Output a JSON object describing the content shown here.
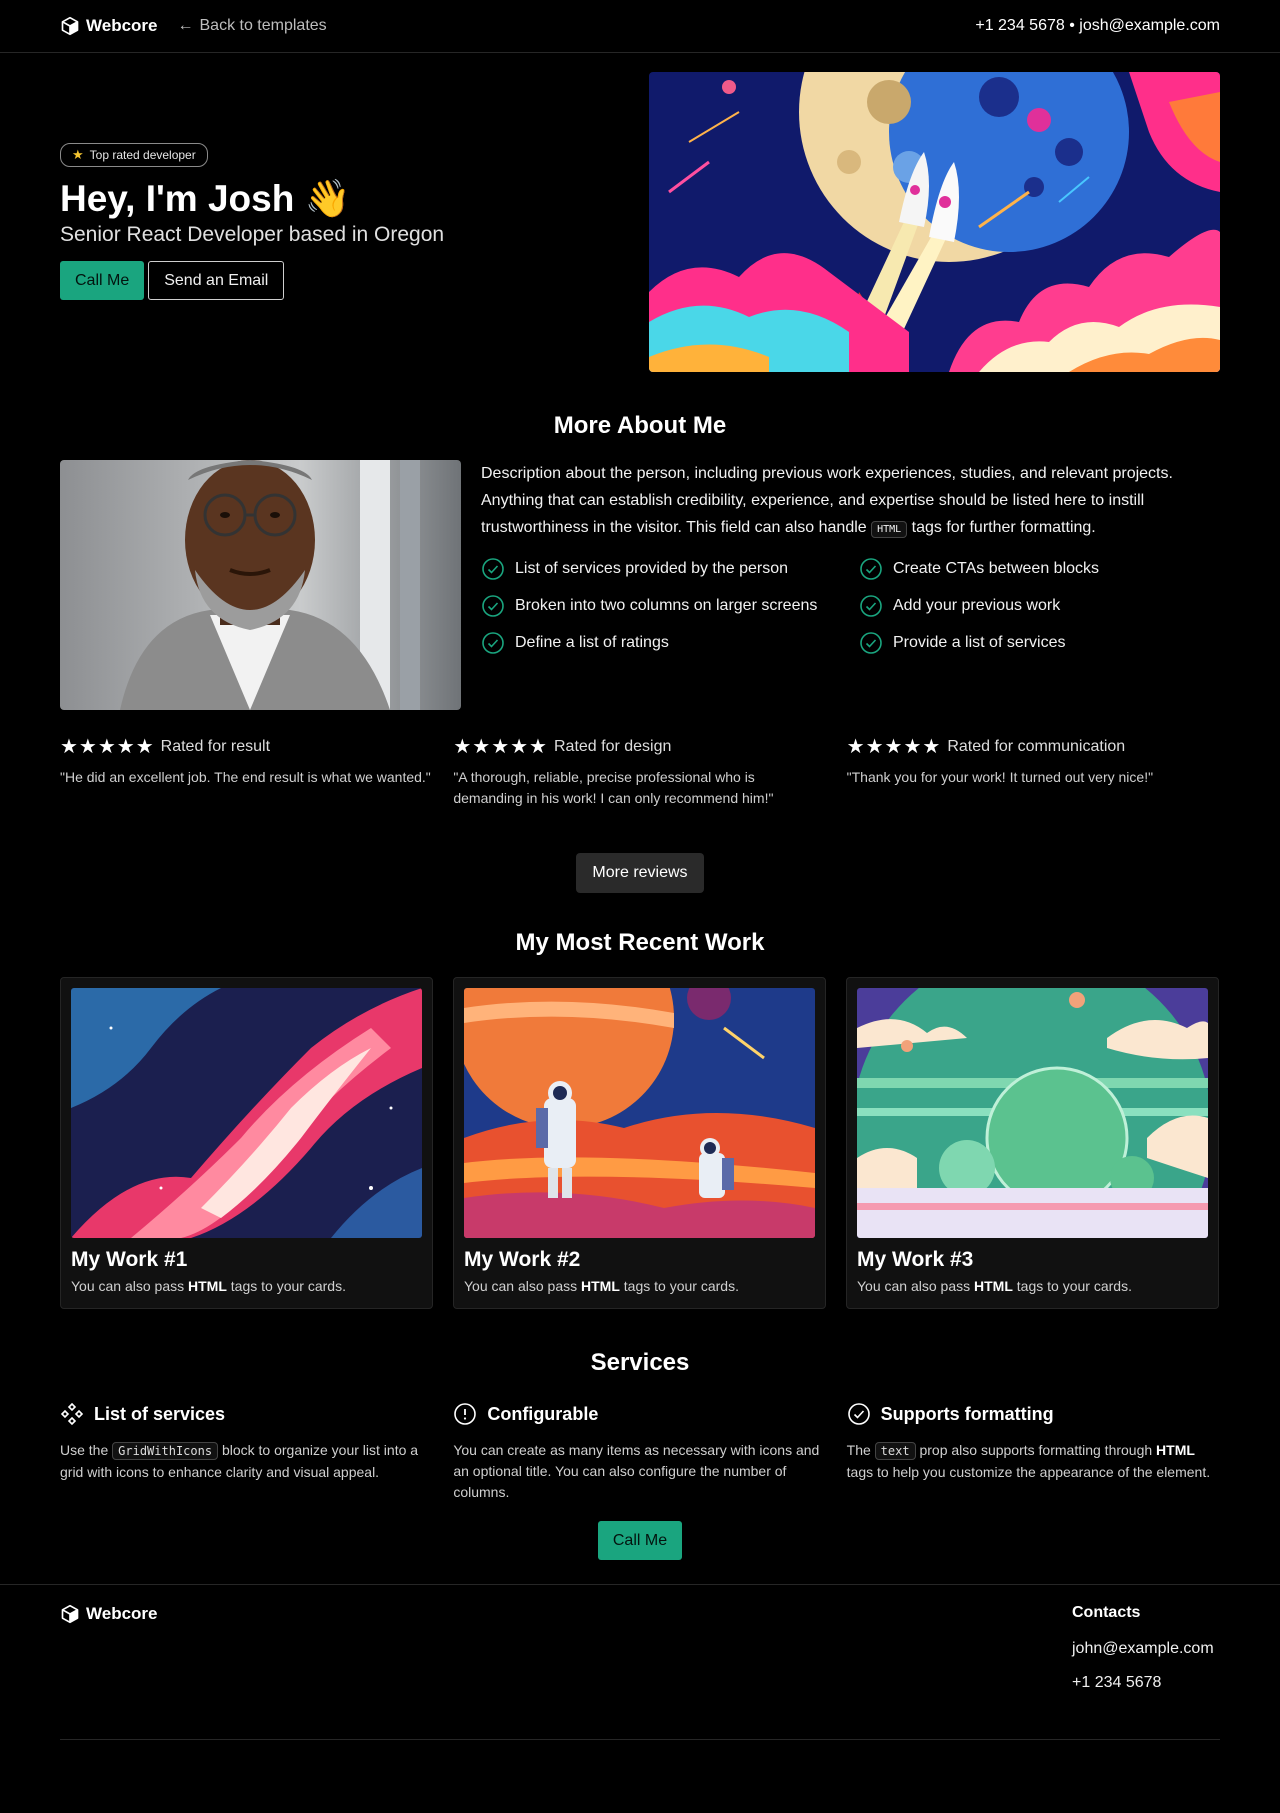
{
  "header": {
    "brand": "Webcore",
    "back": "Back to templates",
    "contact": "+1 234 5678 • josh@example.com"
  },
  "hero": {
    "badge": "Top rated developer",
    "title": "Hey, I'm Josh 👋",
    "subtitle": "Senior React Developer based in Oregon",
    "call_button": "Call Me",
    "email_button": "Send an Email"
  },
  "about": {
    "title": "More About Me",
    "desc_before": "Description about the person, including previous work experiences, studies, and relevant projects. Anything that can establish credibility, experience, and expertise should be listed here to instill trustworthiness in the visitor. This field can also handle ",
    "desc_code": "HTML",
    "desc_after": " tags for further formatting.",
    "features": [
      "List of services provided by the person",
      "Create CTAs between blocks",
      "Broken into two columns on larger screens",
      "Add your previous work",
      "Define a list of ratings",
      "Provide a list of services"
    ]
  },
  "ratings": [
    {
      "stars": "★★★★★",
      "label": "Rated for result",
      "quote": "\"He did an excellent job. The end result is what we wanted.\""
    },
    {
      "stars": "★★★★★",
      "label": "Rated for design",
      "quote": "\"A thorough, reliable, precise professional who is demanding in his work! I can only recommend him!\""
    },
    {
      "stars": "★★★★★",
      "label": "Rated for communication",
      "quote": "\"Thank you for your work! It turned out very nice!\""
    }
  ],
  "more_reviews": "More reviews",
  "work": {
    "title": "My Most Recent Work",
    "cards": [
      {
        "title": "My Work #1",
        "pre": "You can also pass ",
        "bold": "HTML",
        "post": " tags to your cards."
      },
      {
        "title": "My Work #2",
        "pre": "You can also pass ",
        "bold": "HTML",
        "post": " tags to your cards."
      },
      {
        "title": "My Work #3",
        "pre": "You can also pass ",
        "bold": "HTML",
        "post": " tags to your cards."
      }
    ]
  },
  "services": {
    "title": "Services",
    "items": [
      {
        "title": "List of services",
        "icon": "grid-diamond-icon"
      },
      {
        "title": "Configurable",
        "icon": "alert-circle-icon"
      },
      {
        "title": "Supports formatting",
        "icon": "check-circle-icon"
      }
    ],
    "s1_pre": "Use the ",
    "s1_code": "GridWithIcons",
    "s1_post": " block to organize your list into a grid with icons to enhance clarity and visual appeal.",
    "s2": "You can create as many items as necessary with icons and an optional title. You can also configure the number of columns.",
    "s3_pre": "The ",
    "s3_code": "text",
    "s3_mid": " prop also supports formatting through ",
    "s3_bold": "HTML",
    "s3_post": " tags to help you customize the appearance of the element.",
    "call_button": "Call Me"
  },
  "footer": {
    "brand": "Webcore",
    "contacts_title": "Contacts",
    "email": "john@example.com",
    "phone": "+1 234 5678"
  },
  "colors": {
    "accent": "#1aa57f",
    "background": "#000000",
    "card": "#111111"
  }
}
